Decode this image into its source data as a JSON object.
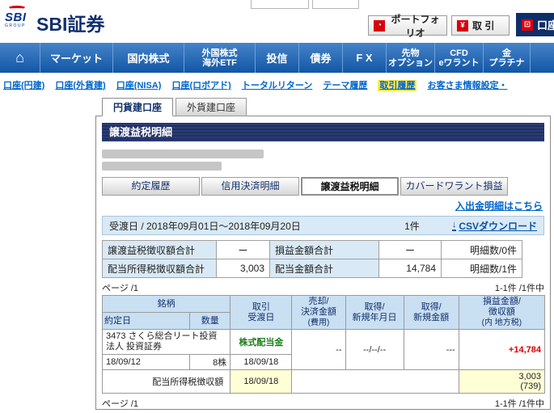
{
  "icons": {
    "home": "⌂",
    "portfolio": "◔",
    "trade": "¥",
    "account": "⊡",
    "download": "↓"
  },
  "colors": {
    "nav_blue": "#1B5FAE",
    "accent_red": "#D7000F",
    "navy": "#0E2E69",
    "link_blue": "#0066CC",
    "profit_red": "#D80000",
    "dividend_green": "#1E7D1E",
    "highlight_yellow": "#FFFFD6"
  },
  "header": {
    "logo_text": "SBI",
    "logo_group": "GROUP",
    "brand": "SBI証券",
    "portfolio_button": "ポートフォリオ",
    "trade_button": "取 引",
    "account_button": "口座"
  },
  "nav": {
    "items": [
      {
        "l1": "マーケット",
        "l2": ""
      },
      {
        "l1": "国内株式",
        "l2": ""
      },
      {
        "l1": "外国株式",
        "l2": "海外ETF"
      },
      {
        "l1": "投信",
        "l2": ""
      },
      {
        "l1": "債券",
        "l2": ""
      },
      {
        "l1": "F X",
        "l2": ""
      },
      {
        "l1": "先物",
        "l2": "オプション"
      },
      {
        "l1": "CFD",
        "l2": "eワラント"
      },
      {
        "l1": "金",
        "l2": "プラチナ"
      }
    ]
  },
  "subnav": {
    "links": [
      "口座(円建)",
      "口座(外貨建)",
      "口座(NISA)",
      "口座(ロボアド)",
      "トータルリターン",
      "テーマ履歴",
      "取引履歴",
      "お客さま情報設定・"
    ]
  },
  "account_tabs": {
    "jpy": "円貨建口座",
    "foreign": "外貨建口座"
  },
  "page": {
    "title": "譲渡益税明細"
  },
  "detail_tabs": [
    "約定履歴",
    "信用決済明細",
    "譲渡益税明細",
    "カバードワラント損益"
  ],
  "links": {
    "deposit_detail": "入出金明細はこちら",
    "csv_download": "CSVダウンロード"
  },
  "filter": {
    "period_label": "受渡日 / 2018年09月01日～2018年09月20日",
    "count": "1件"
  },
  "summary": {
    "rows": [
      {
        "h1": "譲渡益税徴収額合計",
        "v1": "ー",
        "h2": "損益金額合計",
        "v2": "ー",
        "count": "明細数/0件"
      },
      {
        "h1": "配当所得税徴収額合計",
        "v1": "3,003",
        "h2": "配当金額合計",
        "v2": "14,784",
        "count": "明細数/1件"
      }
    ]
  },
  "pager": {
    "page": "ページ /1",
    "range": "1-1件 /1件中"
  },
  "table": {
    "headers": {
      "meigara": "銘柄",
      "yakujou_date": "約定日",
      "quantity": "数量",
      "trade_l1": "取引",
      "trade_l2": "受渡日",
      "sell_l1": "売却/",
      "sell_l2": "決済金額",
      "sell_l3": "(費用)",
      "acq_date_l1": "取得/",
      "acq_date_l2": "新規年月日",
      "acq_amt_l1": "取得/",
      "acq_amt_l2": "新規金額",
      "pl_l1": "損益金額/",
      "pl_l2": "徴収額",
      "pl_l3": "(内 地方税)"
    },
    "row": {
      "name_l1": "3473 さくら総合リート投資",
      "name_l2": "法人 投資証券",
      "trade_type": "株式配当金",
      "yakujou_date": "18/09/12",
      "quantity": "8株",
      "ukewatashi_date": "18/09/18",
      "sell_amount": "--",
      "acq_date": "--/--/--",
      "acq_amount": "---",
      "profit": "+14,784"
    },
    "tax_row": {
      "label": "配当所得税徴収額",
      "date": "18/09/18",
      "amount": "3,003",
      "local_tax": "(739)"
    }
  }
}
